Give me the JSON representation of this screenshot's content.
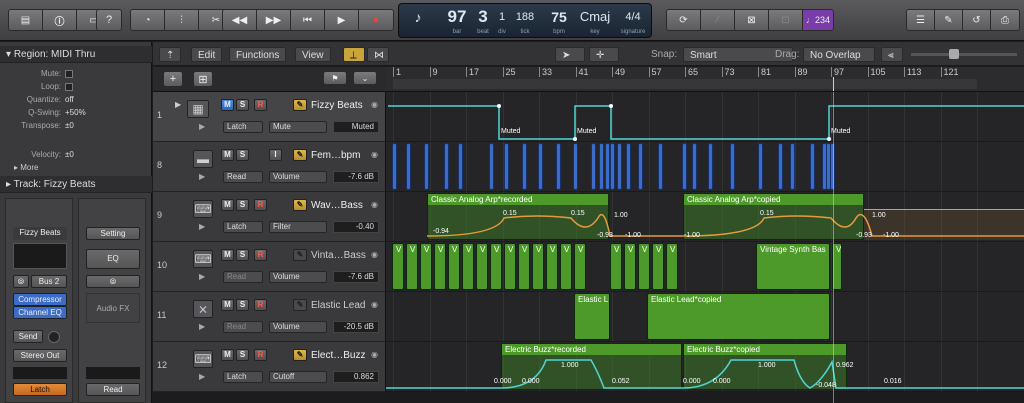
{
  "control_bar": {
    "lcd": {
      "bar": "97",
      "beat": "3",
      "div": "1",
      "tick": "188",
      "tempo": "75",
      "key": "Cmaj",
      "signature": "4/4",
      "labels": {
        "bar": "bar",
        "beat": "beat",
        "div": "div",
        "tick": "tick",
        "tempo": "bpm",
        "key": "key",
        "signature": "signature"
      }
    },
    "icons": [
      "library-icon",
      "info-icon",
      "toolbar-icon",
      "help-icon",
      "smart-controls-icon",
      "mixer-icon",
      "editors-icon",
      "rewind-icon",
      "fast-forward-icon",
      "go-to-start-icon",
      "play-icon",
      "record-icon",
      "cycle-icon",
      "tuner-icon",
      "solo-icon",
      "count-in-icon",
      "list-editors-icon",
      "note-pad-icon",
      "loop-browser-icon",
      "media-browser-icon"
    ],
    "count_in_label": "♩234"
  },
  "inspector": {
    "region_header": "Region: MIDI Thru",
    "region_params": [
      {
        "key": "Mute:",
        "value": ""
      },
      {
        "key": "Loop:",
        "value": ""
      },
      {
        "key": "Quantize:",
        "value": "off"
      },
      {
        "key": "Q-Swing:",
        "value": "+50%"
      },
      {
        "key": "Transpose:",
        "value": "±0"
      },
      {
        "key": "Velocity:",
        "value": "±0"
      }
    ],
    "more_label": "More",
    "track_header": "Track:  Fizzy Beats",
    "strip_left": {
      "name": "Fizzy Beats",
      "bus": "Bus 2",
      "plugins": [
        "Compressor",
        "Channel EQ"
      ],
      "send": "Send",
      "output": "Stereo Out",
      "automation": "Latch"
    },
    "strip_right": {
      "setting": "Setting",
      "eq": "EQ",
      "audio_fx": "Audio FX",
      "automation": "Read"
    }
  },
  "tracks_toolbar": {
    "edit": "Edit",
    "functions": "Functions",
    "view": "View",
    "snap_label": "Snap:",
    "snap_value": "Smart",
    "drag_label": "Drag:",
    "drag_value": "No Overlap"
  },
  "ruler": {
    "bars": [
      "1",
      "9",
      "17",
      "25",
      "33",
      "41",
      "49",
      "57",
      "65",
      "73",
      "81",
      "89",
      "97",
      "105",
      "113",
      "121"
    ]
  },
  "tracks": [
    {
      "num": "1",
      "name": "Fizzy Beats",
      "mode": "Latch",
      "param": "Mute",
      "value": "Muted",
      "has_r": true,
      "dim": false,
      "icon": "drum-machine-icon"
    },
    {
      "num": "8",
      "name": "Fem…bpm",
      "mode": "Read",
      "param": "Volume",
      "value": "-7.6 dB",
      "has_r": false,
      "dim": false,
      "icon": "audio-waveform-icon"
    },
    {
      "num": "9",
      "name": "Wav…Bass",
      "mode": "Latch",
      "param": "Filter",
      "value": "-0.40",
      "has_r": true,
      "dim": false,
      "icon": "synth-keyboard-icon"
    },
    {
      "num": "10",
      "name": "Vinta…Bass",
      "mode": "Read",
      "param": "Volume",
      "value": "-7.6 dB",
      "has_r": true,
      "dim": true,
      "icon": "synth-keyboard-icon"
    },
    {
      "num": "11",
      "name": "Elastic Lead",
      "mode": "Read",
      "param": "Volume",
      "value": "-20.5 dB",
      "has_r": true,
      "dim": true,
      "icon": "keyboard-stand-icon"
    },
    {
      "num": "12",
      "name": "Elect…Buzz",
      "mode": "Latch",
      "param": "Cutoff",
      "value": "0.862",
      "has_r": true,
      "dim": false,
      "icon": "synth-keyboard-icon"
    }
  ],
  "regions": {
    "muted": "Muted",
    "arp_recorded": "Classic Analog Arp*recorded",
    "arp_copied": "Classic Analog Arp*copied",
    "vintage": "Vintage Synth Bas",
    "vintage_v": "V",
    "elastic_a": "Elastic L",
    "elastic_b": "Elastic Lead*copied",
    "buzz_recorded": "Electric Buzz*recorded",
    "buzz_copied": "Electric Buzz*copied"
  },
  "automation_labels": {
    "t9": [
      "-0.94",
      "0.15",
      "0.15",
      "1.00",
      "-0.93",
      "-1.00",
      "-1.00",
      "0.15",
      "1.00",
      "-0.93",
      "-1.00"
    ],
    "t12": [
      "0.000",
      "0.000",
      "1.000",
      "0.052",
      "0.000",
      "0.000",
      "1.000",
      "0.962",
      "-0.048",
      "0.016"
    ]
  }
}
